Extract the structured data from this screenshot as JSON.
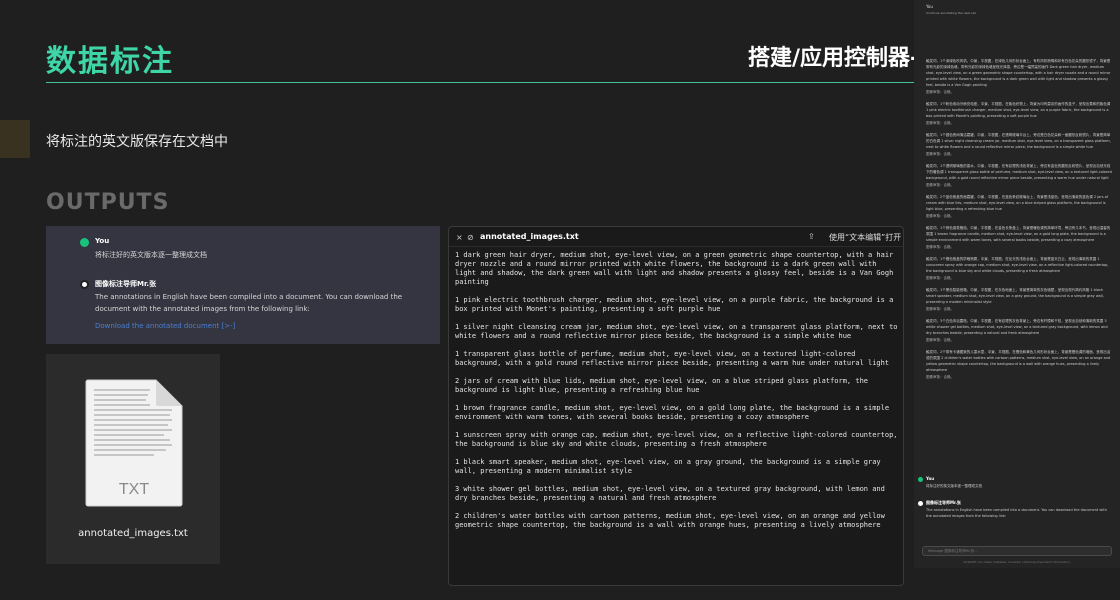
{
  "header": {
    "title": "数据标注",
    "brand": "搭建/应用控制器-Chat GPT",
    "subtitle": "将标注的英文版保存在文档中",
    "section": "OUTPUTS"
  },
  "chat": {
    "user_name": "You",
    "user_text": "将标注好的英文版本逐一整理成文档",
    "bot_name": "图像标注导师Mr.张",
    "bot_text": "The annotations in English have been compiled into a document. You can download the document with the annotated images from the following link:",
    "link_text": "Download the annotated document [>-]",
    "colors": {
      "user": "#19c37d",
      "bot": "#ffffff"
    }
  },
  "file_tile": {
    "ext": "TXT",
    "name": "annotated_images.txt"
  },
  "editor": {
    "close_icon": "×",
    "ban_icon": "⊘",
    "filename": "annotated_images.txt",
    "share_icon": "⇪",
    "open_with": "使用“文本编辑”打开",
    "lines": [
      "1 dark green hair dryer, medium shot, eye-level view, on a green geometric shape countertop, with a hair dryer nozzle and a round mirror printed with white flowers, the background is a dark green wall with light and shadow, the dark green wall with light and shadow presents a glossy feel, beside is a Van Gogh painting",
      "1 pink electric toothbrush charger, medium shot, eye-level view, on a purple fabric, the background is a box printed with Monet's painting, presenting a soft purple hue",
      "1 silver night cleansing cream jar, medium shot, eye-level view, on a transparent glass platform, next to white flowers and a round reflective mirror piece beside, the background is a simple white hue",
      "1 transparent glass bottle of perfume, medium shot, eye-level view, on a textured light-colored background, with a gold round reflective mirror piece beside, presenting a warm hue under natural light",
      "2 jars of cream with blue lids, medium shot, eye-level view, on a blue striped glass platform, the background is light blue, presenting a refreshing blue hue",
      "1 brown fragrance candle, medium shot, eye-level view, on a gold long plate, the background is a simple environment with warm tones, with several books beside, presenting a cozy atmosphere",
      "1 sunscreen spray with orange cap, medium shot, eye-level view, on a reflective light-colored countertop, the background is blue sky and white clouds, presenting a fresh atmosphere",
      "1 black smart speaker, medium shot, eye-level view, on a gray ground, the background is a simple gray wall, presenting a modern minimalist style",
      "3 white shower gel bottles, medium shot, eye-level view, on a textured gray background, with lemon and dry branches beside, presenting a natural and fresh atmosphere",
      "2 children's water bottles with cartoon patterns, medium shot, eye-level view, on an orange and yellow geometric shape countertop, the background is a wall with orange hues, presenting a lively atmosphere"
    ]
  },
  "strip": {
    "top_title": "You",
    "top_sub": "Continue annotating the next set",
    "paragraphs": [
      {
        "text": "触发词，1个深绿色吹风机，中景，平视图，在绿色几何形状台面上，有吹风机喷嘴和印有白色花朵的圆形镜子，背景是带有光影的深绿色墙，带有光影的深绿色墙呈现光泽感，旁边是一幅梵高的画作 Dark green hair dryer, medium shot, eye-level view, on a green geometric shape countertop, with a hair dryer nozzle and a round mirror printed with white flowers, the background is a dark green wall with light and shadow presents a glossy feel, beside is a Van Gogh painting",
        "sub": "图像审核：合格。"
      },
      {
        "text": "触发词，1个粉色电动牙刷充电座，中景，平视图，在紫色织物上，背景为印有莫奈的画作的盒子，呈现出柔和的紫色调 1 pink electric toothbrush charger, medium shot, eye-level view, on a purple fabric, the background is a box printed with Monet's painting, presenting a soft purple hue",
        "sub": "图像审核：合格。"
      },
      {
        "text": "触发词，1个银色夜间清洁霜罐，中景，平视图，在透明玻璃平台上，旁边是白色花朵和一面圆形反射镜片，背景是简单的白色调 1 silver night cleansing cream jar, medium shot, eye-level view, on a transparent glass platform, next to white flowers and a round reflective mirror piece, the background is a simple white hue",
        "sub": "图像审核：合格。"
      },
      {
        "text": "触发词，1个透明玻璃瓶的香水，中景，平视图，在有纹理的浅色背景上，旁边有金色的圆形反射镜片，呈现出自然光线下的暖色调 1 transparent glass bottle of perfume, medium shot, eye-level view, on a textured light-colored background, with a gold round reflective mirror piece beside, presenting a warm hue under natural light",
        "sub": "图像审核：合格。"
      },
      {
        "text": "触发词，2个蓝色瓶盖的面霜罐，中景，平视图，在蓝色条纹玻璃台上，背景是浅蓝色，呈现出清爽的蓝色调 2 jars of cream with blue lids, medium shot, eye-level view, on a blue striped glass platform, the background is light blue, presenting a refreshing blue hue",
        "sub": "图像审核：合格。"
      },
      {
        "text": "触发词，1个棕色香薰蜡烛，中景，平视图，在金色长条盘上，背景是暖色调的简单环境，旁边有几本书，呈现出温馨的氛围 1 brown fragrance candle, medium shot, eye-level view, on a gold long plate, the background is a simple environment with warm tones, with several books beside, presenting a cozy atmosphere",
        "sub": "图像审核：合格。"
      },
      {
        "text": "触发词，1个橙色瓶盖的防晒喷雾，中景，平视图，在反光的浅色台面上，背景是蓝天白云，呈现出清新的氛围 1 sunscreen spray with orange cap, medium shot, eye-level view, on a reflective light-colored countertop, the background is blue sky and white clouds, presenting a fresh atmosphere",
        "sub": "图像审核：合格。"
      },
      {
        "text": "触发词，1个黑色智能音箱，中景，平视图，在灰色地面上，背景是简单的灰色墙壁，呈现出现代简约风格 1 black smart speaker, medium shot, eye-level view, on a gray ground, the background is a simple gray wall, presenting a modern minimalist style",
        "sub": "图像审核：合格。"
      },
      {
        "text": "触发词，3个白色沐浴露瓶，中景，平视图，在有纹理的灰色背景上，旁边有柠檬和干枝，呈现出自然和清新的氛围 3 white shower gel bottles, medium shot, eye-level view, on a textured gray background, with lemon and dry branches beside, presenting a natural and fresh atmosphere",
        "sub": "图像审核：合格。"
      },
      {
        "text": "触发词，2个带有卡通图案的儿童水壶，中景，平视图，在橙色和黄色几何形状台面上，背景是橙色调的墙面，呈现出活泼的氛围 2 children's water bottles with cartoon patterns, medium shot, eye-level view, on an orange and yellow geometric shape countertop, the background is a wall with orange hues, presenting a lively atmosphere",
        "sub": "图像审核：合格。"
      }
    ],
    "you_name": "You",
    "you_text": "将标注好的英文版本逐一整理成文档",
    "bot_name": "图像标注导师Mr.张",
    "bot_text": "The annotations in English have been compiled into a document. You can download the document with the annotated images from the following link:",
    "input_placeholder": "Message 图像标注导师Mr.张...",
    "footer": "ChatGPT can make mistakes. Consider checking important information."
  }
}
